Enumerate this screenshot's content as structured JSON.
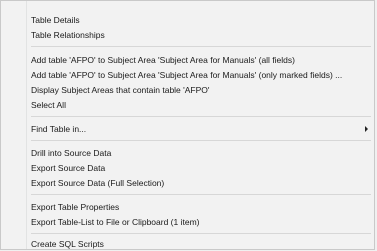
{
  "context_menu": {
    "items": [
      {
        "label": "Table Details"
      },
      {
        "label": "Table Relationships"
      },
      {
        "label": "Add table 'AFPO' to Subject Area 'Subject Area for Manuals' (all fields)"
      },
      {
        "label": "Add table 'AFPO' to Subject Area 'Subject Area for Manuals' (only marked fields) ..."
      },
      {
        "label": "Display Subject Areas that contain table 'AFPO'"
      },
      {
        "label": "Select All"
      },
      {
        "label": "Find Table in...",
        "icon": "chevron-right-icon"
      },
      {
        "label": "Drill into Source Data"
      },
      {
        "label": "Export Source Data"
      },
      {
        "label": "Export Source Data (Full Selection)"
      },
      {
        "label": "Export Table Properties"
      },
      {
        "label": "Export Table-List to File or Clipboard (1 item)"
      },
      {
        "label": "Create SQL Scripts"
      }
    ]
  }
}
